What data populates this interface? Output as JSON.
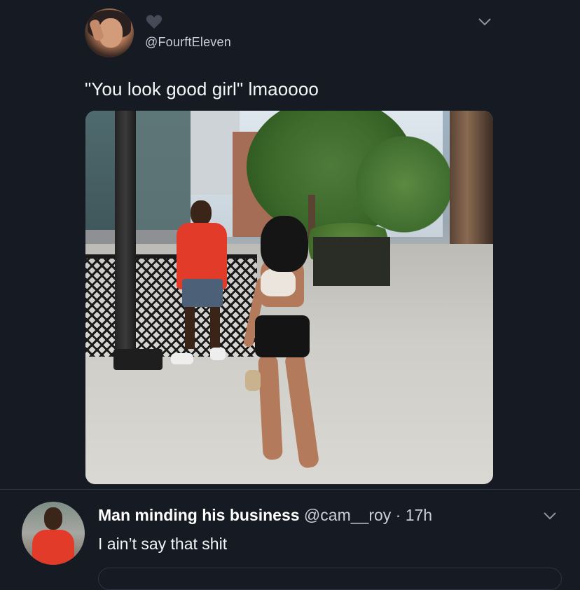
{
  "tweet": {
    "handle": "@FourftEleven",
    "text": "\"You look good girl\" lmaoooo",
    "avatar": "user-avatar",
    "heart_icon": "heart-icon",
    "more_icon": "chevron-down-icon"
  },
  "reply": {
    "name": "Man minding his business",
    "handle_time": " @cam__roy · 17h",
    "text": "I ain’t say that shit",
    "more_icon": "chevron-down-icon"
  },
  "colors": {
    "background": "#151a23",
    "text": "#ffffff",
    "muted": "#c9ced6",
    "divider": "#2c3441"
  }
}
